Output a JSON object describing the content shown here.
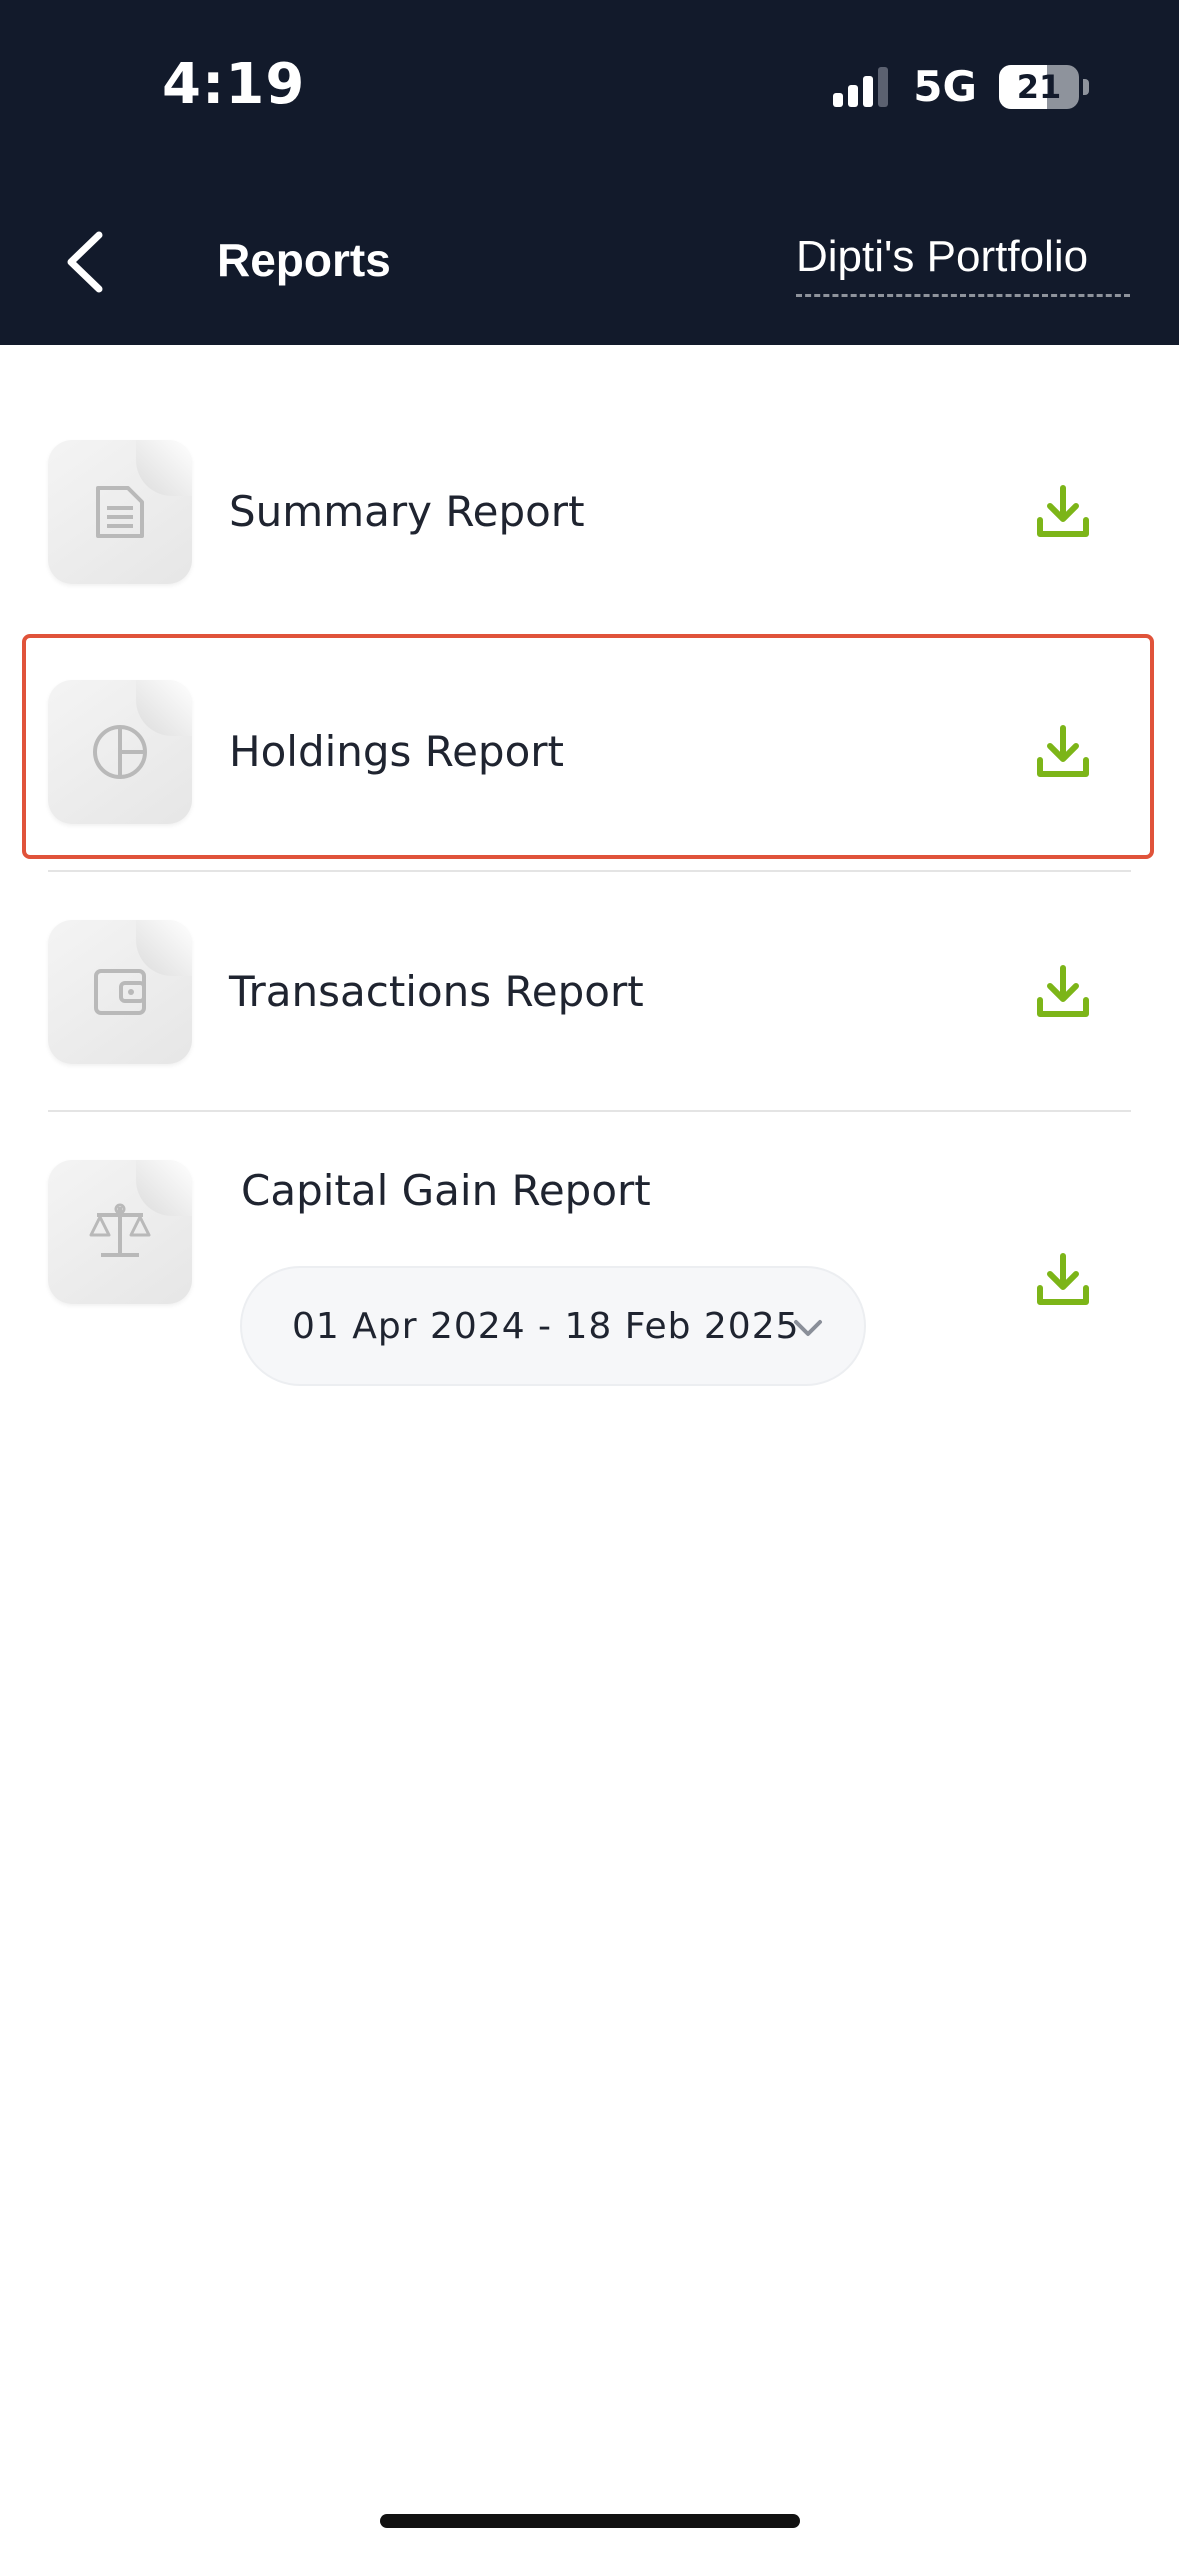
{
  "status_bar": {
    "time": "4:19",
    "network": "5G",
    "battery": "21"
  },
  "header": {
    "title": "Reports",
    "portfolio": "Dipti's Portfolio",
    "back_icon": "chevron-left-icon"
  },
  "reports": [
    {
      "label": "Summary Report",
      "icon": "document-icon"
    },
    {
      "label": "Holdings Report",
      "icon": "pie-chart-icon"
    },
    {
      "label": "Transactions Report",
      "icon": "wallet-icon"
    },
    {
      "label": "Capital Gain Report",
      "icon": "scale-icon"
    }
  ],
  "capital_gain": {
    "date_range": "01 Apr 2024 - 18 Feb 2025"
  },
  "colors": {
    "header_bg": "#121a2b",
    "accent_green": "#7cb518",
    "highlight": "#e0533a"
  }
}
